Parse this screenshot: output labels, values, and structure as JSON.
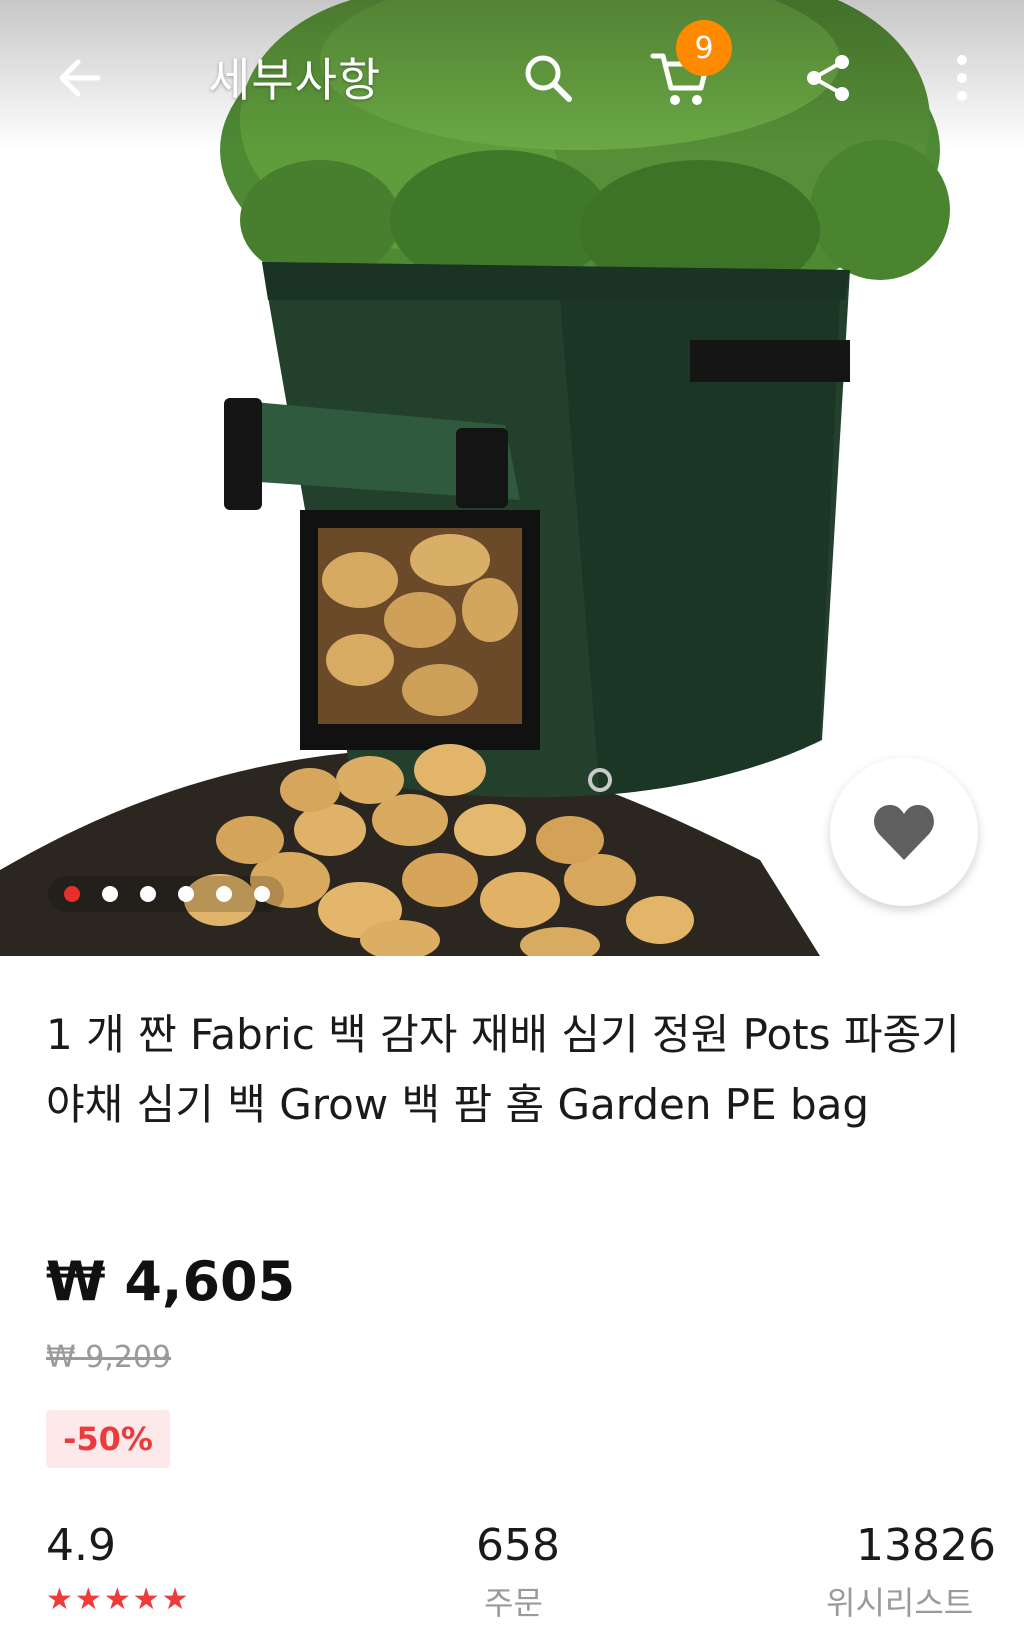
{
  "header": {
    "title": "세부사항",
    "cart_count": "9",
    "icons": {
      "back": "arrow-left-icon",
      "search": "search-icon",
      "cart": "cart-icon",
      "share": "share-icon",
      "more": "more-vertical-icon"
    }
  },
  "gallery": {
    "image": "potato-grow-bag-photo",
    "page_count": 6,
    "active_index": 0,
    "wishlist_icon": "heart-icon"
  },
  "product": {
    "title": "1 개 짠 Fabric 백 감자 재배 심기 정원 Pots 파종기 야채 심기 백 Grow 백 팜 홈 Garden PE bag",
    "price": "₩ 4,605",
    "original_price": "₩ 9,209",
    "discount": "-50%"
  },
  "stats": {
    "rating": "4.9",
    "stars": 5,
    "orders": "658",
    "orders_label": "주문",
    "wishlist": "13826",
    "wishlist_label": "위시리스트"
  },
  "colors": {
    "accent": "#ea3c3c",
    "badge": "#ff8a00",
    "discount_bg": "#fde9ea",
    "muted": "#9a9a9a"
  }
}
